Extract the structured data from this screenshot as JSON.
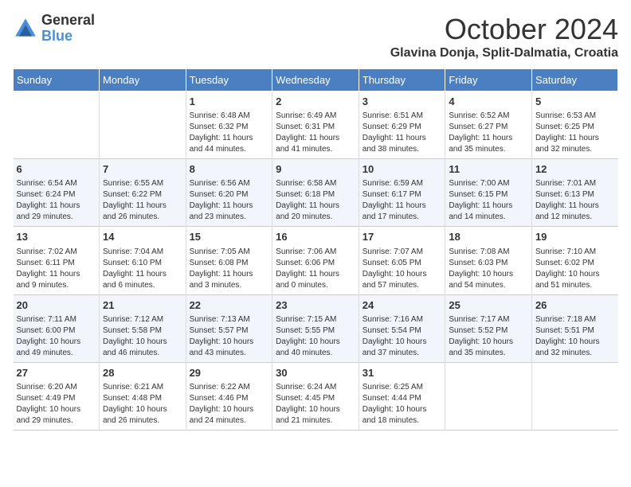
{
  "logo": {
    "general": "General",
    "blue": "Blue"
  },
  "title": "October 2024",
  "location": "Glavina Donja, Split-Dalmatia, Croatia",
  "days_of_week": [
    "Sunday",
    "Monday",
    "Tuesday",
    "Wednesday",
    "Thursday",
    "Friday",
    "Saturday"
  ],
  "weeks": [
    [
      {
        "day": "",
        "content": ""
      },
      {
        "day": "",
        "content": ""
      },
      {
        "day": "1",
        "content": "Sunrise: 6:48 AM\nSunset: 6:32 PM\nDaylight: 11 hours\nand 44 minutes."
      },
      {
        "day": "2",
        "content": "Sunrise: 6:49 AM\nSunset: 6:31 PM\nDaylight: 11 hours\nand 41 minutes."
      },
      {
        "day": "3",
        "content": "Sunrise: 6:51 AM\nSunset: 6:29 PM\nDaylight: 11 hours\nand 38 minutes."
      },
      {
        "day": "4",
        "content": "Sunrise: 6:52 AM\nSunset: 6:27 PM\nDaylight: 11 hours\nand 35 minutes."
      },
      {
        "day": "5",
        "content": "Sunrise: 6:53 AM\nSunset: 6:25 PM\nDaylight: 11 hours\nand 32 minutes."
      }
    ],
    [
      {
        "day": "6",
        "content": "Sunrise: 6:54 AM\nSunset: 6:24 PM\nDaylight: 11 hours\nand 29 minutes."
      },
      {
        "day": "7",
        "content": "Sunrise: 6:55 AM\nSunset: 6:22 PM\nDaylight: 11 hours\nand 26 minutes."
      },
      {
        "day": "8",
        "content": "Sunrise: 6:56 AM\nSunset: 6:20 PM\nDaylight: 11 hours\nand 23 minutes."
      },
      {
        "day": "9",
        "content": "Sunrise: 6:58 AM\nSunset: 6:18 PM\nDaylight: 11 hours\nand 20 minutes."
      },
      {
        "day": "10",
        "content": "Sunrise: 6:59 AM\nSunset: 6:17 PM\nDaylight: 11 hours\nand 17 minutes."
      },
      {
        "day": "11",
        "content": "Sunrise: 7:00 AM\nSunset: 6:15 PM\nDaylight: 11 hours\nand 14 minutes."
      },
      {
        "day": "12",
        "content": "Sunrise: 7:01 AM\nSunset: 6:13 PM\nDaylight: 11 hours\nand 12 minutes."
      }
    ],
    [
      {
        "day": "13",
        "content": "Sunrise: 7:02 AM\nSunset: 6:11 PM\nDaylight: 11 hours\nand 9 minutes."
      },
      {
        "day": "14",
        "content": "Sunrise: 7:04 AM\nSunset: 6:10 PM\nDaylight: 11 hours\nand 6 minutes."
      },
      {
        "day": "15",
        "content": "Sunrise: 7:05 AM\nSunset: 6:08 PM\nDaylight: 11 hours\nand 3 minutes."
      },
      {
        "day": "16",
        "content": "Sunrise: 7:06 AM\nSunset: 6:06 PM\nDaylight: 11 hours\nand 0 minutes."
      },
      {
        "day": "17",
        "content": "Sunrise: 7:07 AM\nSunset: 6:05 PM\nDaylight: 10 hours\nand 57 minutes."
      },
      {
        "day": "18",
        "content": "Sunrise: 7:08 AM\nSunset: 6:03 PM\nDaylight: 10 hours\nand 54 minutes."
      },
      {
        "day": "19",
        "content": "Sunrise: 7:10 AM\nSunset: 6:02 PM\nDaylight: 10 hours\nand 51 minutes."
      }
    ],
    [
      {
        "day": "20",
        "content": "Sunrise: 7:11 AM\nSunset: 6:00 PM\nDaylight: 10 hours\nand 49 minutes."
      },
      {
        "day": "21",
        "content": "Sunrise: 7:12 AM\nSunset: 5:58 PM\nDaylight: 10 hours\nand 46 minutes."
      },
      {
        "day": "22",
        "content": "Sunrise: 7:13 AM\nSunset: 5:57 PM\nDaylight: 10 hours\nand 43 minutes."
      },
      {
        "day": "23",
        "content": "Sunrise: 7:15 AM\nSunset: 5:55 PM\nDaylight: 10 hours\nand 40 minutes."
      },
      {
        "day": "24",
        "content": "Sunrise: 7:16 AM\nSunset: 5:54 PM\nDaylight: 10 hours\nand 37 minutes."
      },
      {
        "day": "25",
        "content": "Sunrise: 7:17 AM\nSunset: 5:52 PM\nDaylight: 10 hours\nand 35 minutes."
      },
      {
        "day": "26",
        "content": "Sunrise: 7:18 AM\nSunset: 5:51 PM\nDaylight: 10 hours\nand 32 minutes."
      }
    ],
    [
      {
        "day": "27",
        "content": "Sunrise: 6:20 AM\nSunset: 4:49 PM\nDaylight: 10 hours\nand 29 minutes."
      },
      {
        "day": "28",
        "content": "Sunrise: 6:21 AM\nSunset: 4:48 PM\nDaylight: 10 hours\nand 26 minutes."
      },
      {
        "day": "29",
        "content": "Sunrise: 6:22 AM\nSunset: 4:46 PM\nDaylight: 10 hours\nand 24 minutes."
      },
      {
        "day": "30",
        "content": "Sunrise: 6:24 AM\nSunset: 4:45 PM\nDaylight: 10 hours\nand 21 minutes."
      },
      {
        "day": "31",
        "content": "Sunrise: 6:25 AM\nSunset: 4:44 PM\nDaylight: 10 hours\nand 18 minutes."
      },
      {
        "day": "",
        "content": ""
      },
      {
        "day": "",
        "content": ""
      }
    ]
  ]
}
